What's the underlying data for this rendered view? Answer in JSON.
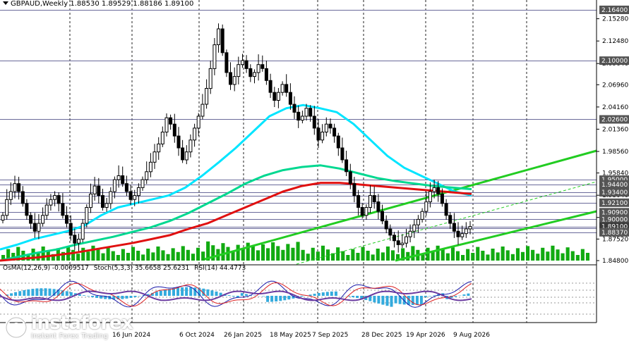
{
  "header": {
    "symbol": "GBPAUD,Weekly",
    "ohlc": [
      "1.88530",
      "1.89529",
      "1.88186",
      "1.89100"
    ]
  },
  "oscillators": {
    "osma": "OsMA(12,26,9) -0.0009517",
    "stoch": "Stoch(5,3,3) 35.6658 25.6231",
    "rsi": "RSI(14) 44.4773"
  },
  "logo": {
    "name": "instaforex",
    "tagline": "Instant Forex Trading"
  },
  "colors": {
    "bull": "#008800",
    "bear": "#000000",
    "ma_fast": "#00e5ff",
    "ma_mid": "#00d890",
    "ma_slow": "#e01010",
    "channel": "#22cc22",
    "level_line": "#6a6a9a",
    "grid": "#222222",
    "volume": "#11aa11",
    "osma_hist": "#33aadd",
    "stoch_main": "#1a1aaa",
    "stoch_signal": "#dd2222",
    "rsi": "#6a3aa0"
  },
  "chart_data": {
    "type": "candlestick",
    "symbol": "GBPAUD",
    "timeframe": "Weekly",
    "ylim": [
      1.848,
      2.164
    ],
    "y_ticks": [
      "2.15280",
      "2.12480",
      "2.09640",
      "2.06960",
      "2.04160",
      "2.01360",
      "1.98560",
      "1.95840",
      "1.93040",
      "1.90240",
      "1.87520",
      "1.84800"
    ],
    "x_tick_labels": [
      "16 Jun 2024",
      "6 Oct 2024",
      "26 Jan 2025",
      "18 May 2025",
      "7 Sep 2025",
      "28 Dec 2025",
      "19 Apr 2026",
      "9 Aug 2026"
    ],
    "levels": [
      "2.16400",
      "2.10000",
      "2.02600",
      "1.95000",
      "1.94400",
      "1.93400",
      "1.93000",
      "1.92100",
      "1.90900",
      "1.90000",
      "1.89100",
      "1.88870",
      "1.88370"
    ],
    "highlighted_levels": [
      "2.16400",
      "2.10000",
      "2.02600",
      "1.95000",
      "1.94400",
      "1.93400",
      "1.92100",
      "1.90900",
      "1.90000",
      "1.89100",
      "1.88370"
    ],
    "current_price": "1.89100",
    "close_series": [
      1.905,
      1.925,
      1.935,
      1.945,
      1.935,
      1.92,
      1.905,
      1.895,
      1.885,
      1.895,
      1.905,
      1.918,
      1.925,
      1.93,
      1.92,
      1.905,
      1.895,
      1.88,
      1.87,
      1.875,
      1.895,
      1.915,
      1.932,
      1.942,
      1.93,
      1.915,
      1.92,
      1.935,
      1.95,
      1.955,
      1.945,
      1.935,
      1.925,
      1.93,
      1.94,
      1.95,
      1.96,
      1.972,
      1.985,
      1.995,
      2.01,
      2.028,
      2.02,
      2.005,
      1.99,
      1.975,
      1.985,
      2.0,
      2.015,
      2.03,
      2.045,
      2.065,
      2.09,
      2.12,
      2.14,
      2.11,
      2.085,
      2.07,
      2.08,
      2.095,
      2.1,
      2.09,
      2.08,
      2.085,
      2.095,
      2.09,
      2.075,
      2.06,
      2.05,
      2.06,
      2.07,
      2.06,
      2.045,
      2.035,
      2.025,
      2.03,
      2.04,
      2.03,
      2.015,
      2.0,
      2.01,
      2.02,
      2.015,
      2.005,
      1.99,
      1.975,
      1.96,
      1.945,
      1.93,
      1.915,
      1.905,
      1.915,
      1.93,
      1.922,
      1.91,
      1.898,
      1.888,
      1.88,
      1.873,
      1.868,
      1.87,
      1.878,
      1.885,
      1.893,
      1.9,
      1.91,
      1.922,
      1.935,
      1.94,
      1.932,
      1.92,
      1.905,
      1.895,
      1.885,
      1.878,
      1.882,
      1.888,
      1.891
    ],
    "moving_averages": [
      {
        "color": "cyan",
        "path": [
          1.862,
          1.868,
          1.875,
          1.88,
          1.885,
          1.892,
          1.905,
          1.915,
          1.92,
          1.925,
          1.93,
          1.94,
          1.955,
          1.972,
          1.99,
          2.01,
          2.03,
          2.04,
          2.044,
          2.04,
          2.035,
          2.02,
          2.0,
          1.98,
          1.965,
          1.955,
          1.945,
          1.935,
          1.93
        ]
      },
      {
        "color": "green",
        "path": [
          1.848,
          1.853,
          1.858,
          1.862,
          1.868,
          1.873,
          1.878,
          1.884,
          1.89,
          1.898,
          1.908,
          1.92,
          1.932,
          1.945,
          1.955,
          1.962,
          1.966,
          1.968,
          1.964,
          1.958,
          1.952,
          1.948,
          1.945,
          1.942,
          1.94,
          1.938
        ]
      },
      {
        "color": "red",
        "path": [
          1.848,
          1.85,
          1.852,
          1.855,
          1.858,
          1.862,
          1.866,
          1.87,
          1.875,
          1.88,
          1.888,
          1.895,
          1.905,
          1.915,
          1.925,
          1.935,
          1.942,
          1.946,
          1.946,
          1.944,
          1.942,
          1.94,
          1.938,
          1.936,
          1.934,
          1.932
        ]
      }
    ]
  }
}
